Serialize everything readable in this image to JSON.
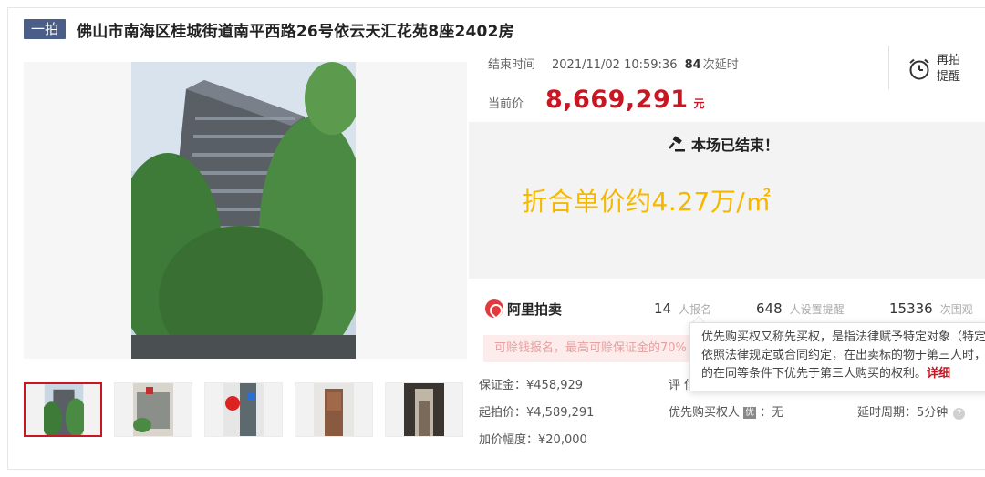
{
  "header": {
    "round_badge": "一拍",
    "lot_title": "佛山市南海区桂城街道南平西路26号依云天汇花苑8座2402房"
  },
  "auction": {
    "end_label": "结束时间",
    "end_time": "2021/11/02 10:59:36",
    "delay_count": "84",
    "delay_text": "次延时",
    "price_label": "当前价",
    "current_price": "8,669,291",
    "price_unit": "元",
    "remind_label": "再拍提醒",
    "ended_text": "本场已结束！",
    "unit_price_text": "折合单价约4.27万/㎡"
  },
  "platform": {
    "name": "阿里拍卖",
    "signups_num": "14",
    "signups_label": "人报名",
    "reminders_num": "648",
    "reminders_label": "人设置提醒",
    "views_num": "15336",
    "views_label": "次围观"
  },
  "deposit_alert": "可赊钱报名，最高可赊保证金的70%",
  "details": {
    "deposit": "保证金：¥458,929",
    "starting_price": "起拍价：¥4,589,291",
    "increment": "加价幅度：¥20,000",
    "appraisal_partial": "评 估",
    "preemptive": "优先购买权人",
    "preemptive_tag": "优",
    "preemptive_value": "：无",
    "delay_period": "延时周期：5分钟"
  },
  "tooltip": {
    "line1": "优先购买权又称先买权，是指法律赋予特定对象（特定",
    "line2": "依照法律规定或合同约定，在出卖标的物于第三人时，享",
    "line3": "的在同等条件下优先于第三人购买的权利。",
    "more": "详细"
  },
  "icons": {
    "zoom": "search-icon",
    "remind": "alarm-clock-icon",
    "ended": "gavel-icon",
    "help": "question-icon"
  },
  "colors": {
    "accent": "#c81623",
    "badge": "#4a5e88",
    "unit_price": "#f5b800"
  }
}
